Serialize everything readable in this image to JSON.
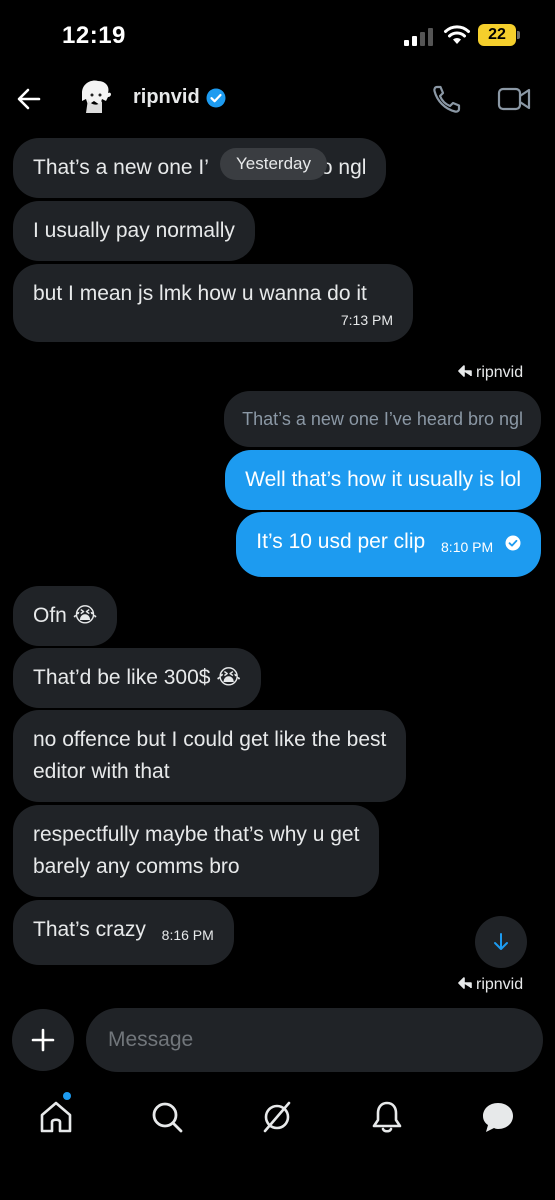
{
  "status_bar": {
    "time": "12:19",
    "battery": "22"
  },
  "header": {
    "name": "ripnvid"
  },
  "conversation": {
    "date_pill": "Yesterday",
    "incoming_1": {
      "msg1_start": "That’s a new one I’",
      "msg1_end": "o ngl",
      "msg2": "I usually pay normally",
      "msg3": "but I mean js lmk how u wanna do it",
      "time": "7:13 PM"
    },
    "reply_to_label": "ripnvid",
    "quoted": "That’s a new one I’ve heard bro ngl",
    "outgoing": {
      "msg1": "Well that’s how it usually is lol",
      "msg2": "It’s 10 usd per clip",
      "time": "8:10 PM"
    },
    "incoming_2": {
      "msg1": "Ofn",
      "msg1_emoji": "😭",
      "msg2": "That’d be like 300$",
      "msg2_emoji": "😭",
      "msg3_line1": "no offence but I could get like the best",
      "msg3_line2": "editor with that",
      "msg4_line1": "respectfully maybe that’s why u get",
      "msg4_line2": "barely any comms bro",
      "msg5": "That’s crazy",
      "time": "8:16 PM"
    },
    "bottom_reply_label": "ripnvid"
  },
  "composer": {
    "placeholder": "Message"
  },
  "tabs": [
    "home-icon",
    "search-icon",
    "grok-icon",
    "notifications-icon",
    "messages-icon"
  ],
  "colors": {
    "accent": "#1d9bf0",
    "incoming_bubble": "#202327",
    "background": "#000000"
  }
}
